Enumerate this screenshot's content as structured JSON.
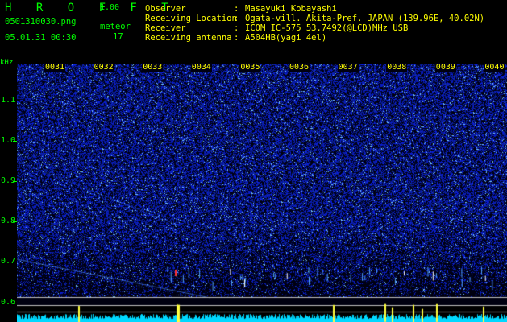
{
  "header": {
    "app_name": "H R O F F T",
    "version": "1.00",
    "filename": "0501310030.png",
    "datetime": "05.01.31 00:30",
    "meteor_label": "meteor",
    "meteor_count": "17",
    "fields": [
      {
        "key": "Observer",
        "value": "Masayuki Kobayashi"
      },
      {
        "key": "Receiving Location",
        "value": "Ogata-vill. Akita-Pref. JAPAN (139.96E, 40.02N)"
      },
      {
        "key": "Receiver",
        "value": "ICOM IC-575 53.7492(@LCD)MHz USB"
      },
      {
        "key": "Receiving antenna",
        "value": "A504HB(yagi 4el)"
      }
    ]
  },
  "plot": {
    "y_unit": "kHz",
    "y_ticks": [
      "1.1",
      "1.0",
      "0.9",
      "0.8",
      "0.7",
      "0.6"
    ],
    "time_labels": [
      "0031",
      "0032",
      "0033",
      "0034",
      "0035",
      "0036",
      "0037",
      "0038",
      "0039",
      "0040"
    ],
    "colors": {
      "background": "#000010",
      "noise": "#2040c0",
      "trace": "#00e0ff",
      "spike": "#ffff00",
      "axis": "#00ff00"
    }
  }
}
